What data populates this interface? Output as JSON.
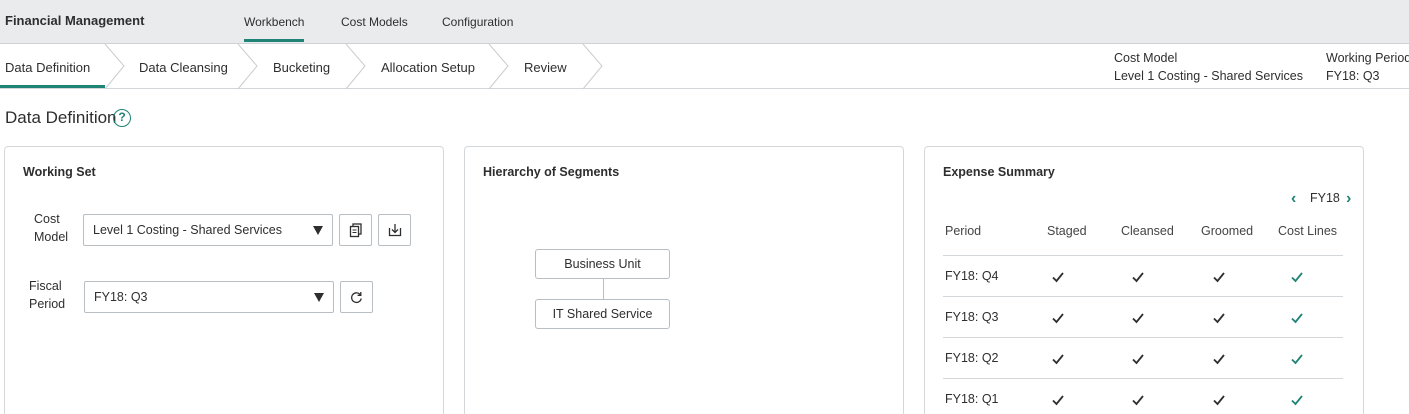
{
  "header": {
    "app_title": "Financial Management",
    "tabs": [
      {
        "label": "Workbench",
        "active": true
      },
      {
        "label": "Cost Models",
        "active": false
      },
      {
        "label": "Configuration",
        "active": false
      }
    ]
  },
  "steps": [
    {
      "label": "Data Definition",
      "active": true
    },
    {
      "label": "Data Cleansing",
      "active": false
    },
    {
      "label": "Bucketing",
      "active": false
    },
    {
      "label": "Allocation Setup",
      "active": false
    },
    {
      "label": "Review",
      "active": false
    }
  ],
  "context": {
    "cost_model_label": "Cost Model",
    "cost_model_value": "Level 1 Costing - Shared Services",
    "working_period_label": "Working Period",
    "working_period_value": "FY18: Q3"
  },
  "page_title": "Data Definition",
  "working_set": {
    "title": "Working Set",
    "cost_model_label_line1": "Cost",
    "cost_model_label_line2": "Model",
    "cost_model_value": "Level 1 Costing - Shared Services",
    "fiscal_period_label_line1": "Fiscal",
    "fiscal_period_label_line2": "Period",
    "fiscal_period_value": "FY18: Q3"
  },
  "hierarchy": {
    "title": "Hierarchy of Segments",
    "nodes": [
      "Business Unit",
      "IT Shared Service"
    ]
  },
  "expense_summary": {
    "title": "Expense Summary",
    "year": "FY18",
    "columns": [
      "Period",
      "Staged",
      "Cleansed",
      "Groomed",
      "Cost Lines"
    ],
    "rows": [
      {
        "period": "FY18: Q4",
        "staged": true,
        "cleansed": true,
        "groomed": true,
        "cost_lines": true
      },
      {
        "period": "FY18: Q3",
        "staged": true,
        "cleansed": true,
        "groomed": true,
        "cost_lines": true
      },
      {
        "period": "FY18: Q2",
        "staged": true,
        "cleansed": true,
        "groomed": true,
        "cost_lines": true
      },
      {
        "period": "FY18: Q1",
        "staged": true,
        "cleansed": true,
        "groomed": true,
        "cost_lines": true
      }
    ]
  },
  "colors": {
    "accent": "#1f8476",
    "check_dark": "#2e2e2e",
    "check_accent": "#1f8476"
  }
}
